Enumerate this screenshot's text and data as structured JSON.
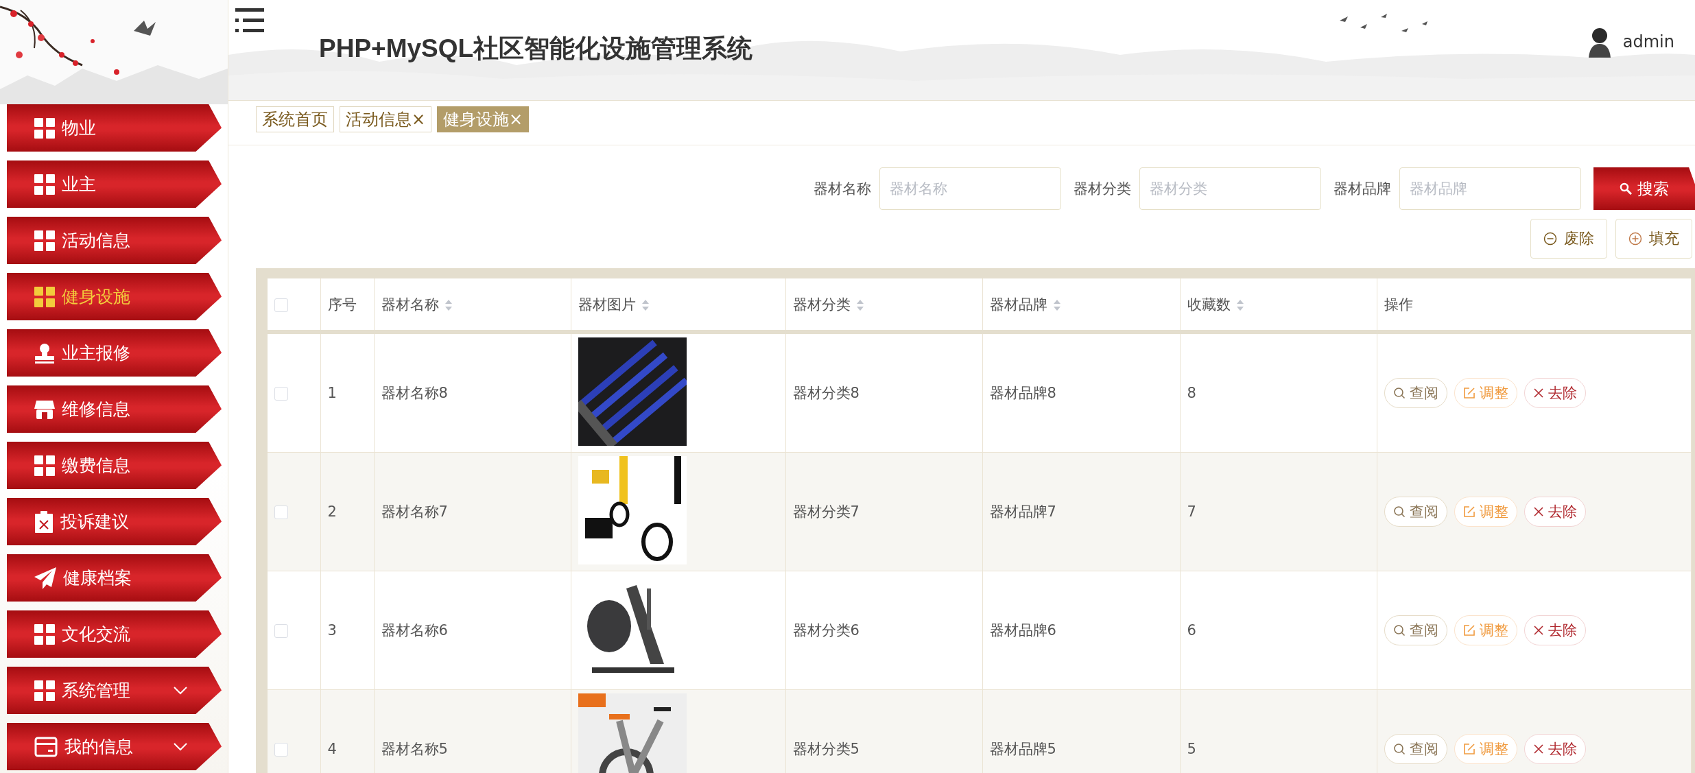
{
  "sidebar": {
    "items": [
      {
        "label": "物业",
        "kind": "grid",
        "selected": false,
        "has_submenu": false
      },
      {
        "label": "业主",
        "kind": "grid",
        "selected": false,
        "has_submenu": false
      },
      {
        "label": "活动信息",
        "kind": "grid",
        "selected": false,
        "has_submenu": false
      },
      {
        "label": "健身设施",
        "kind": "grid",
        "selected": true,
        "has_submenu": false
      },
      {
        "label": "业主报修",
        "kind": "stamp",
        "selected": false,
        "has_submenu": false
      },
      {
        "label": "维修信息",
        "kind": "shop",
        "selected": false,
        "has_submenu": false
      },
      {
        "label": "缴费信息",
        "kind": "grid",
        "selected": false,
        "has_submenu": false
      },
      {
        "label": "投诉建议",
        "kind": "clipboard",
        "selected": false,
        "has_submenu": false
      },
      {
        "label": "健康档案",
        "kind": "plane",
        "selected": false,
        "has_submenu": false
      },
      {
        "label": "文化交流",
        "kind": "grid",
        "selected": false,
        "has_submenu": false
      },
      {
        "label": "系统管理",
        "kind": "grid",
        "selected": false,
        "has_submenu": true
      },
      {
        "label": "我的信息",
        "kind": "card",
        "selected": false,
        "has_submenu": true
      }
    ]
  },
  "header": {
    "title": "PHP+MySQL社区智能化设施管理系统",
    "user": "admin"
  },
  "tabs": [
    {
      "label": "系统首页",
      "selected": false
    },
    {
      "label": "活动信息",
      "close": "×",
      "selected": false
    },
    {
      "label": "健身设施",
      "close": "×",
      "selected": true
    }
  ],
  "search": {
    "fields": [
      {
        "label": "器材名称",
        "placeholder": "器材名称"
      },
      {
        "label": "器材分类",
        "placeholder": "器材分类"
      },
      {
        "label": "器材品牌",
        "placeholder": "器材品牌"
      }
    ],
    "button": "搜索",
    "actions": [
      {
        "label": "废除",
        "kind": "remove"
      },
      {
        "label": "填充",
        "kind": "add"
      }
    ]
  },
  "table": {
    "select_all": {
      "checked": false
    },
    "columns": [
      {
        "label": "序号",
        "sortable": false
      },
      {
        "label": "器材名称",
        "sortable": true
      },
      {
        "label": "器材图片",
        "sortable": true
      },
      {
        "label": "器材分类",
        "sortable": true
      },
      {
        "label": "器材品牌",
        "sortable": true
      },
      {
        "label": "收藏数",
        "sortable": true
      },
      {
        "label": "操作",
        "sortable": false
      }
    ],
    "rows": [
      {
        "checked": false,
        "index": "1",
        "name": "器材名称8",
        "image": {
          "kind": "picture"
        },
        "category": "器材分类8",
        "brand": "器材品牌8",
        "favorites": "8",
        "actions": [
          {
            "label": "查阅",
            "kind": "view"
          },
          {
            "label": "调整",
            "kind": "edit"
          },
          {
            "label": "去除",
            "kind": "delete"
          }
        ]
      },
      {
        "checked": false,
        "index": "2",
        "name": "器材名称7",
        "image": {
          "kind": "picture"
        },
        "category": "器材分类7",
        "brand": "器材品牌7",
        "favorites": "7",
        "actions": [
          {
            "label": "查阅",
            "kind": "view"
          },
          {
            "label": "调整",
            "kind": "edit"
          },
          {
            "label": "去除",
            "kind": "delete"
          }
        ]
      },
      {
        "checked": false,
        "index": "3",
        "name": "器材名称6",
        "image": {
          "kind": "picture"
        },
        "category": "器材分类6",
        "brand": "器材品牌6",
        "favorites": "6",
        "actions": [
          {
            "label": "查阅",
            "kind": "view"
          },
          {
            "label": "调整",
            "kind": "edit"
          },
          {
            "label": "去除",
            "kind": "delete"
          }
        ]
      },
      {
        "checked": false,
        "index": "4",
        "name": "器材名称5",
        "image": {
          "kind": "picture"
        },
        "category": "器材分类5",
        "brand": "器材品牌5",
        "favorites": "5",
        "actions": [
          {
            "label": "查阅",
            "kind": "view"
          },
          {
            "label": "调整",
            "kind": "edit"
          },
          {
            "label": "去除",
            "kind": "delete"
          }
        ]
      }
    ]
  }
}
